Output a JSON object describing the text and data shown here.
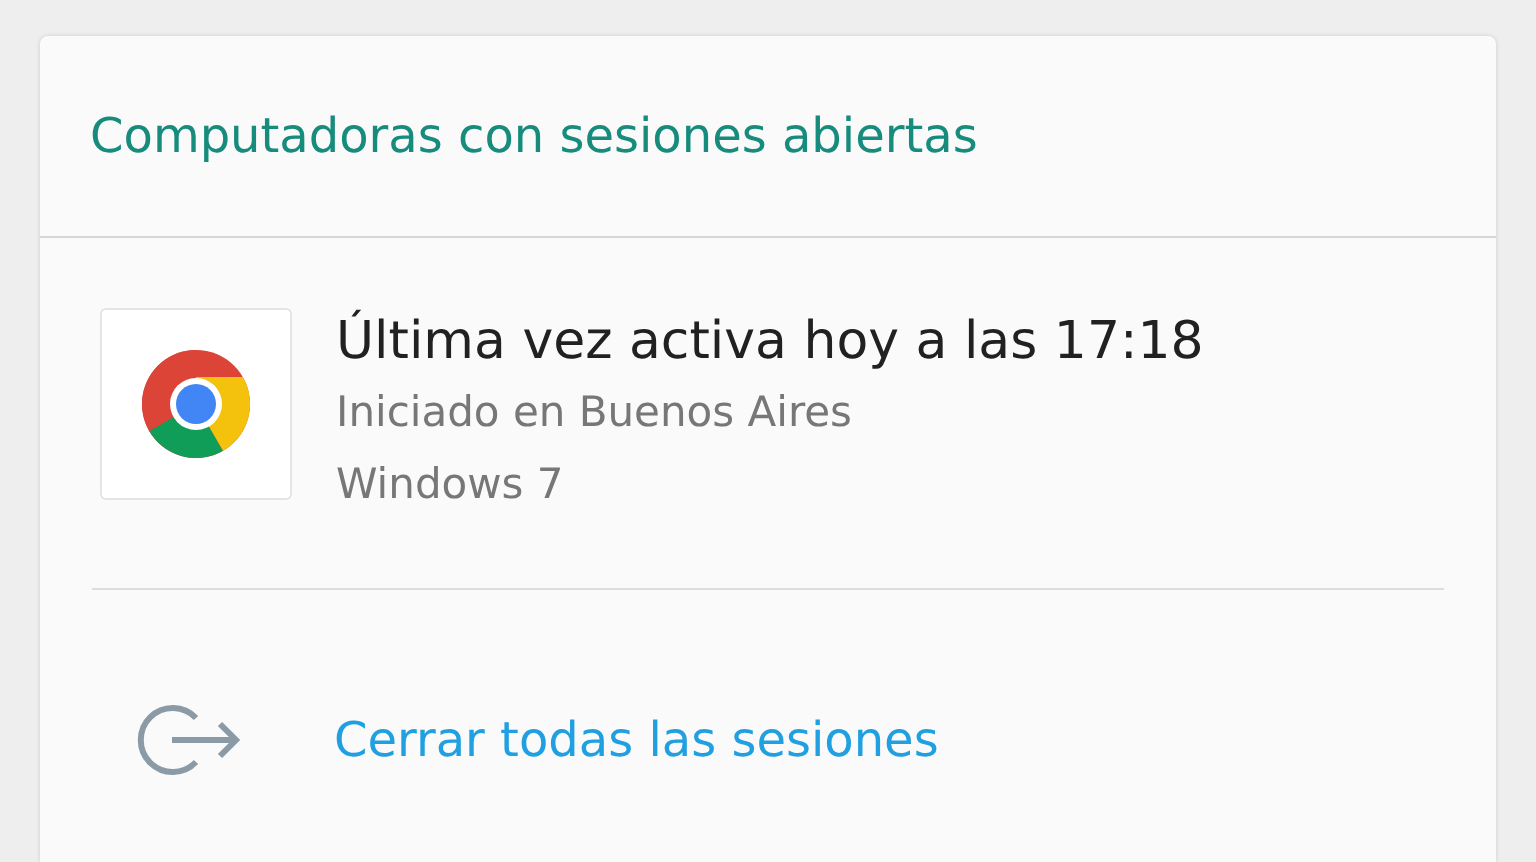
{
  "section": {
    "title": "Computadoras con sesiones abiertas"
  },
  "session": {
    "title": "Última vez activa hoy a las 17:18",
    "lines": [
      "Iniciado en Buenos Aires",
      "Windows 7"
    ]
  },
  "action": {
    "label": "Cerrar todas las sesiones"
  }
}
